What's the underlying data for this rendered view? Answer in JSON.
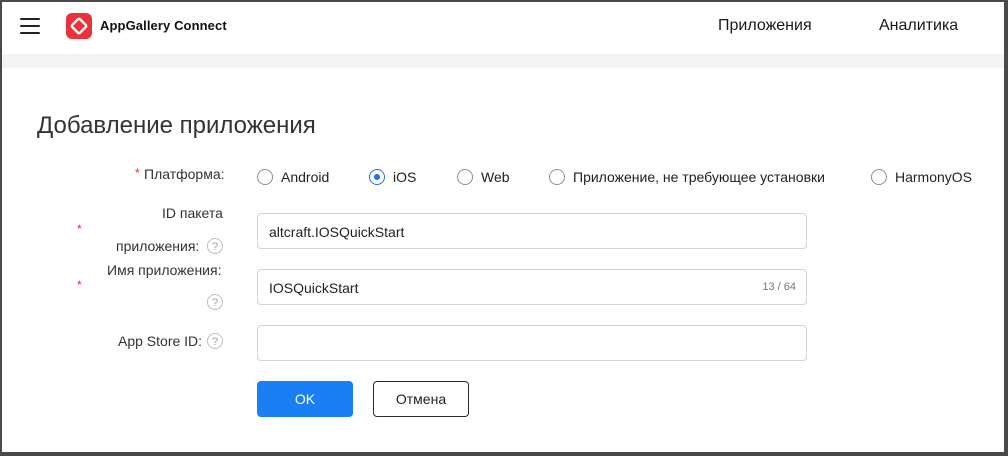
{
  "header": {
    "brand": "AppGallery Connect",
    "nav": [
      "Приложения",
      "Аналитика"
    ],
    "accent_color": "#e8333b"
  },
  "page": {
    "title": "Добавление приложения"
  },
  "form": {
    "platform": {
      "label": "Платформа:",
      "required": "*",
      "options": [
        "Android",
        "iOS",
        "Web",
        "Приложение, не требующее установки",
        "HarmonyOS"
      ],
      "selected": "iOS"
    },
    "package_id": {
      "label_line1": "ID пакета",
      "label_line2": "приложения:",
      "required": "*",
      "value": "altcraft.IOSQuickStart"
    },
    "app_name": {
      "label": "Имя приложения:",
      "required": "*",
      "value": "IOSQuickStart",
      "counter": "13 / 64"
    },
    "app_store_id": {
      "label": "App Store ID:",
      "value": ""
    },
    "help_glyph": "?"
  },
  "buttons": {
    "ok": "OK",
    "cancel": "Отмена",
    "primary_color": "#1a7ef5"
  }
}
